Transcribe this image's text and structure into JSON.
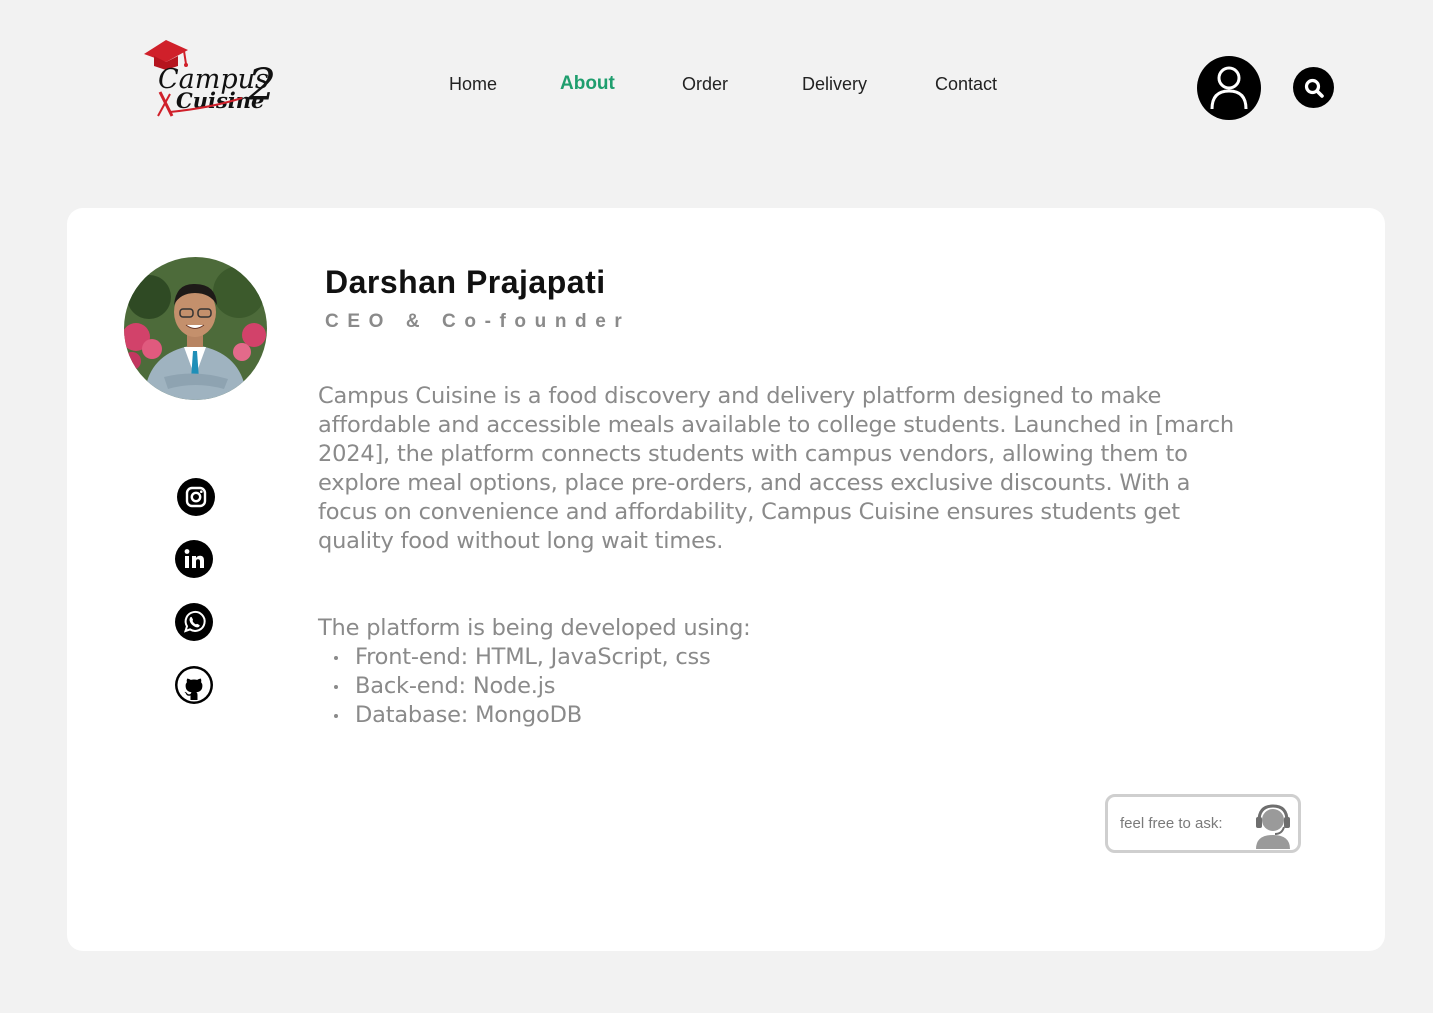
{
  "brand": {
    "logo_line1": "Campus",
    "logo_line2": "Cuisine",
    "logo_number": "2",
    "accent_color": "#d0202a"
  },
  "nav": {
    "items": [
      {
        "label": "Home",
        "active": false
      },
      {
        "label": "About",
        "active": true
      },
      {
        "label": "Order",
        "active": false
      },
      {
        "label": "Delivery",
        "active": false
      },
      {
        "label": "Contact",
        "active": false
      }
    ],
    "active_color": "#1f9e6e"
  },
  "header": {
    "user_icon": "user-icon",
    "search_icon": "search-icon"
  },
  "profile": {
    "name": "Darshan Prajapati",
    "role": "CEO & Co-founder",
    "bio": "Campus Cuisine is a food discovery and delivery platform designed to make affordable and accessible meals available to college students. Launched in [march 2024], the platform connects students with campus vendors, allowing them to explore meal options, place pre-orders, and access exclusive discounts. With a focus on convenience and affordability, Campus Cuisine ensures students get quality food without long wait times.",
    "stack_title": "The platform is being developed using:",
    "stack": [
      "Front-end: HTML, JavaScript, css",
      "Back-end: Node.js",
      "Database: MongoDB"
    ]
  },
  "social": [
    "instagram-icon",
    "linkedin-icon",
    "whatsapp-icon",
    "github-icon"
  ],
  "help": {
    "label": "feel free to ask:",
    "icon": "support-agent-icon"
  }
}
